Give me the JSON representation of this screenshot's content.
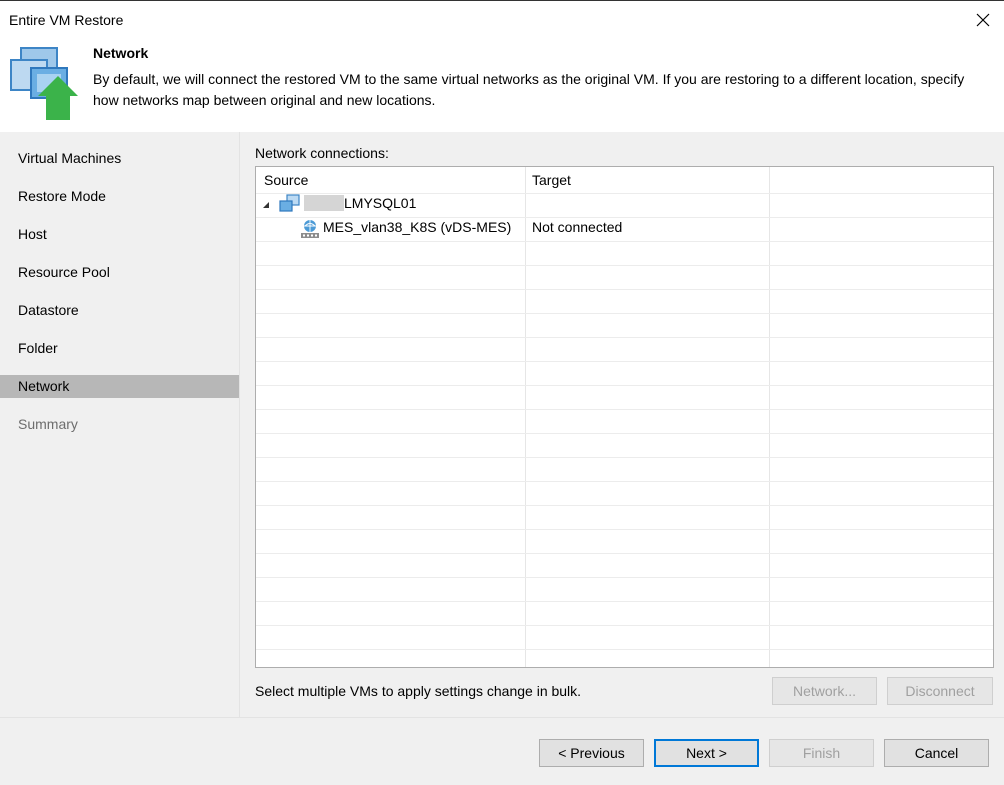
{
  "window": {
    "title": "Entire VM Restore"
  },
  "header": {
    "title": "Network",
    "description": "By default, we will connect the restored VM to the same virtual networks as the original VM. If you are restoring to a different location, specify how networks map between original and new locations.",
    "icon": "restore-vm-icon"
  },
  "sidebar": {
    "items": [
      {
        "label": "Virtual Machines",
        "state": "normal"
      },
      {
        "label": "Restore Mode",
        "state": "normal"
      },
      {
        "label": "Host",
        "state": "normal"
      },
      {
        "label": "Resource Pool",
        "state": "normal"
      },
      {
        "label": "Datastore",
        "state": "normal"
      },
      {
        "label": "Folder",
        "state": "normal"
      },
      {
        "label": "Network",
        "state": "active"
      },
      {
        "label": "Summary",
        "state": "disabled"
      }
    ]
  },
  "main": {
    "connections_label": "Network connections:",
    "columns": [
      "Source",
      "Target"
    ],
    "rows": [
      {
        "source": "LMYSQL01",
        "target": "",
        "level": 0,
        "expanded": true,
        "icon": "vm-group-icon"
      },
      {
        "source": "MES_vlan38_K8S (vDS-MES)",
        "target": "Not connected",
        "level": 1,
        "icon": "network-icon"
      }
    ],
    "bulk_hint": "Select multiple VMs to apply settings change in bulk.",
    "network_button": "Network...",
    "disconnect_button": "Disconnect"
  },
  "footer": {
    "previous": "< Previous",
    "next": "Next >",
    "finish": "Finish",
    "cancel": "Cancel"
  },
  "colors": {
    "sidebar_bg": "#f0f0f0",
    "sidebar_active": "#b7b7b7",
    "primary_border": "#0078d7",
    "icon_blue": "#4b9ad6",
    "icon_green": "#3bb34a"
  }
}
